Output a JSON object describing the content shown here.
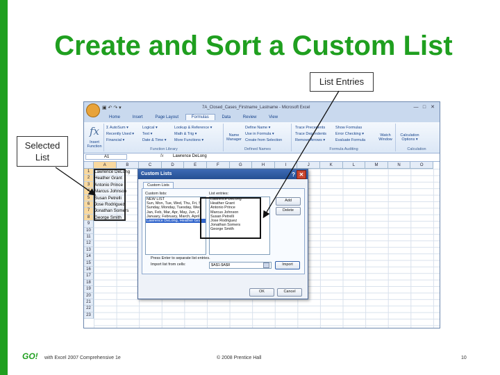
{
  "slide": {
    "title": "Create and Sort a Custom List",
    "callout_list_entries": "List Entries",
    "callout_selected_list_line1": "Selected",
    "callout_selected_list_line2": "List",
    "footer_left": "with Excel 2007 Comprehensive 1e",
    "footer_logo": "GO!",
    "footer_center": "© 2008 Prentice Hall",
    "page_number": "10",
    "accent_color": "#1f9f1f"
  },
  "excel": {
    "title": "7A_Closed_Cases_Firstname_Lastname - Microsoft Excel",
    "tabs": [
      "Home",
      "Insert",
      "Page Layout",
      "Formulas",
      "Data",
      "Review",
      "View"
    ],
    "active_tab": "Formulas",
    "ribbon": {
      "insert_function": "Insert Function",
      "function_library": {
        "label": "Function Library",
        "items": [
          "Σ AutoSum ▾",
          "Recently Used ▾",
          "Financial ▾",
          "Logical ▾",
          "Text ▾",
          "Date & Time ▾",
          "Lookup & Reference ▾",
          "Math & Trig ▾",
          "More Functions ▾"
        ]
      },
      "defined_names": {
        "label": "Defined Names",
        "name_manager": "Name Manager",
        "items": [
          "Define Name ▾",
          "Use in Formula ▾",
          "Create from Selection"
        ]
      },
      "formula_auditing": {
        "label": "Formula Auditing",
        "items": [
          "Trace Precedents",
          "Trace Dependents",
          "Remove Arrows ▾",
          "Show Formulas",
          "Error Checking ▾",
          "Evaluate Formula"
        ],
        "watch_window": "Watch Window"
      },
      "calculation": {
        "label": "Calculation",
        "options": "Calculation Options ▾"
      }
    },
    "namebox": "A1",
    "formula": "Lawrence DeLong",
    "columns": [
      "A",
      "B",
      "C",
      "D",
      "E",
      "F",
      "G",
      "H",
      "I",
      "J",
      "K",
      "L",
      "M",
      "N",
      "O"
    ],
    "rows": [
      "1",
      "2",
      "3",
      "4",
      "5",
      "6",
      "7",
      "8",
      "9",
      "10",
      "11",
      "12",
      "13",
      "14",
      "15",
      "16",
      "17",
      "18",
      "19",
      "20",
      "21",
      "22",
      "23"
    ],
    "cells": [
      "Lawrence DeLong",
      "Heather Grant",
      "Antonio Prince",
      "Marcus Johnson",
      "Susan Petrelli",
      "Jose Rodriguez",
      "Jonathan Somers",
      "George Smith"
    ]
  },
  "dialog": {
    "title": "Custom Lists",
    "help": "?",
    "close": "✕",
    "tab": "Custom Lists",
    "custom_lists_label": "Custom lists:",
    "custom_lists": [
      "NEW LIST",
      "Sun, Mon, Tue, Wed, Thu, Fri, S",
      "Sunday, Monday, Tuesday, Wec",
      "Jan, Feb, Mar, Apr, May, Jun, J",
      "January, February, March, April",
      "Lawrence DeLong, Heather Gra"
    ],
    "selected_list_index": 5,
    "list_entries_label": "List entries:",
    "list_entries": [
      "Lawrence DeLong",
      "Heather Grant",
      "Antonio Prince",
      "Marcus Johnson",
      "Susan Petrelli",
      "Jose Rodriguez",
      "Jonathan Somers",
      "George Smith"
    ],
    "add": "Add",
    "delete": "Delete",
    "hint": "Press Enter to separate list entries.",
    "import_label": "Import list from cells:",
    "import_value": "$A$1:$A$8",
    "import": "Import",
    "ok": "OK",
    "cancel": "Cancel"
  }
}
